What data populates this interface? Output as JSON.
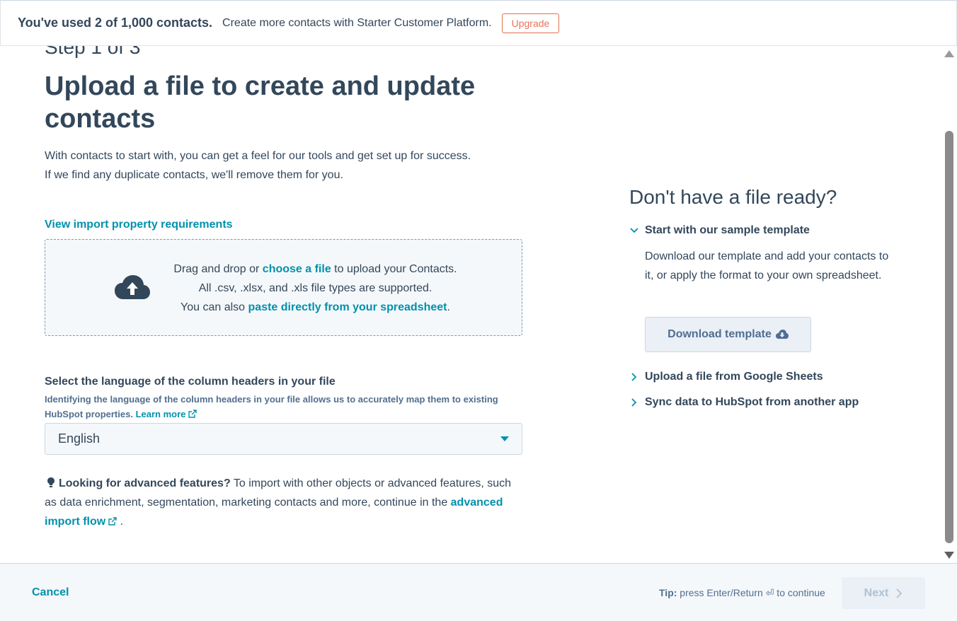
{
  "banner": {
    "usage_text": "You've used 2 of 1,000 contacts.",
    "promo_text": "Create more contacts with Starter Customer Platform.",
    "upgrade_label": "Upgrade"
  },
  "main": {
    "step_label": "Step 1 of 3",
    "title": "Upload a file to create and update contacts",
    "desc_line1": "With contacts to start with, you can get a feel for our tools and get set up for success.",
    "desc_line2": "If we find any duplicate contacts, we'll remove them for you.",
    "requirements_link": "View import property requirements",
    "dropzone": {
      "line1_prefix": "Drag and drop or ",
      "line1_link": "choose a file",
      "line1_suffix": " to upload your Contacts.",
      "line2": "All .csv, .xlsx, and .xls file types are supported.",
      "line3_prefix": "You can also ",
      "line3_link": "paste directly from your spreadsheet",
      "line3_suffix": "."
    },
    "language": {
      "label": "Select the language of the column headers in your file",
      "help_text": "Identifying the language of the column headers in your file allows us to accurately map them to existing HubSpot properties. ",
      "learn_more": "Learn more",
      "selected": "English"
    },
    "advanced": {
      "bold_text": "Looking for advanced features?",
      "text": " To import with other objects or advanced features, such as data enrichment, segmentation, marketing contacts and more, continue in the ",
      "link": "advanced import flow",
      "suffix": " ."
    }
  },
  "sidebar": {
    "title": "Don't have a file ready?",
    "sample_template": {
      "label": "Start with our sample template",
      "body": "Download our template and add your contacts to it, or apply the format to your own spreadsheet.",
      "button": "Download template"
    },
    "google_sheets_label": "Upload a file from Google Sheets",
    "sync_label": "Sync data to HubSpot from another app"
  },
  "footer": {
    "cancel_label": "Cancel",
    "tip_bold": "Tip:",
    "tip_text": " press Enter/Return ⏎ to continue",
    "next_label": "Next"
  },
  "colors": {
    "text": "#33475b",
    "link": "#0091ae",
    "upgrade": "#e66e50",
    "panel_bg": "#f5f8fa"
  }
}
